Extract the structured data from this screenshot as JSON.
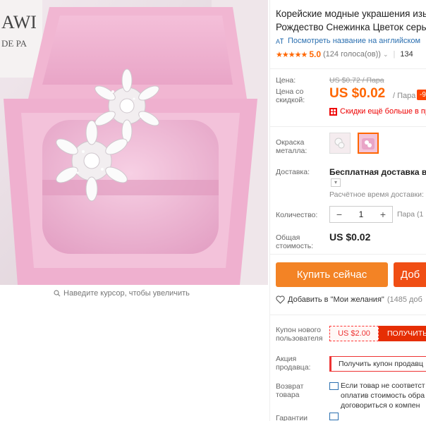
{
  "product": {
    "title_line1": "Корейские модные украшения изы",
    "title_line2": "Рождество Снежинка Цветок серьг",
    "translate_link": "Посмотреть название на английском",
    "rating": {
      "stars": "★★★★★",
      "value": "5.0",
      "votes": "(124 голоса(ов))",
      "orders": "134"
    }
  },
  "pricing": {
    "price_label": "Цена:",
    "old_price": "US $0.72 / Пара",
    "discount_label": "Цена со скидкой:",
    "price": "US $0.02",
    "unit": "/ Пара",
    "discount_badge": "-9",
    "promo": "Скидки ещё больше в пр"
  },
  "options": {
    "color_label": "Окраска металла:",
    "shipping_label": "Доставка:",
    "shipping_value": "Бесплатная доставка в Ru",
    "eta": "Расчётное время доставки:",
    "qty_label": "Количество:",
    "qty_value": "1",
    "qty_unit": "Пара (1",
    "total_label": "Общая стоимость:",
    "total_value": "US $0.02"
  },
  "actions": {
    "buy": "Купить сейчас",
    "cart": "Доб",
    "wish": "Добавить в \"Мои желания\"",
    "wish_count": "(1485 доб"
  },
  "coupons": {
    "new_user_label": "Купон нового пользователя",
    "new_user_amount": "US $2.00",
    "new_user_btn": "ПОЛУЧИТЬ",
    "seller_label": "Акция продавца:",
    "seller_btn": "Получить купон продавц"
  },
  "returns": {
    "label": "Возврат товара",
    "line1": "Если товар не соответст",
    "line2": "оплатив стоимость обра",
    "line3": "договориться о компен"
  },
  "guarantee": {
    "label": "Гарантии"
  },
  "image": {
    "zoom_hint": "Наведите курсор, чтобы увеличить",
    "brand_partial_1": "AWI",
    "brand_partial_2": "DE PA"
  },
  "colors": {
    "accent": "#f60",
    "buy": "#f38325",
    "cart": "#f04e14",
    "coupon": "#e62e04",
    "link": "#2a6fb0"
  }
}
